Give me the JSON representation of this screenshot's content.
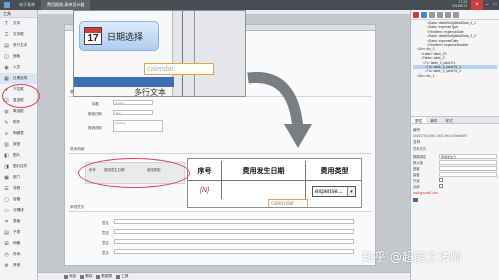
{
  "titlebar": {
    "tabs": [
      "电子表单",
      "费用报销-表单设计器"
    ],
    "clock_time": "17:23",
    "clock_date": "2018/6/13",
    "close_label": "×",
    "minimize_label": "–",
    "maximize_label": "□"
  },
  "toolbox": {
    "header": "工具",
    "items": [
      {
        "icon": "T",
        "label": "文本"
      },
      {
        "icon": "⎕",
        "label": "文本框"
      },
      {
        "icon": "▤",
        "label": "多行文本"
      },
      {
        "icon": "◫",
        "label": "面板"
      },
      {
        "icon": "◉",
        "label": "人员"
      },
      {
        "icon": "▦",
        "label": "日期选择"
      },
      {
        "icon": "▾",
        "label": "下拉框"
      },
      {
        "icon": "☑",
        "label": "复选框"
      },
      {
        "icon": "◍",
        "label": "单选框"
      },
      {
        "icon": "✎",
        "label": "附件"
      },
      {
        "icon": "≡",
        "label": "明细表"
      },
      {
        "icon": "▥",
        "label": "按钮"
      },
      {
        "icon": "◧",
        "label": "图片"
      },
      {
        "icon": "◨",
        "label": "图片控件"
      },
      {
        "icon": "▣",
        "label": "部门"
      },
      {
        "icon": "☰",
        "label": "流程"
      },
      {
        "icon": "▢",
        "label": "容器"
      },
      {
        "icon": "▭",
        "label": "分隔线"
      },
      {
        "icon": "⌗",
        "label": "表格"
      },
      {
        "icon": "▤",
        "label": "子表"
      },
      {
        "icon": "⊞",
        "label": "网格"
      },
      {
        "icon": "◷",
        "label": "时间"
      },
      {
        "icon": "⚙",
        "label": "其他"
      }
    ]
  },
  "canvas": {
    "section1_title": "基本信息",
    "section1_fields": [
      {
        "label": "标题",
        "placeholder": "textbox"
      },
      {
        "label": "报销日期",
        "placeholder": "date"
      },
      {
        "label": "报销说明",
        "placeholder": "textarea"
      }
    ],
    "section2_title": "费用明细",
    "table_headers": [
      "序号",
      "费用发生日期",
      "费用类型"
    ],
    "section3_title": "审批意见",
    "approval_rows": [
      "意见",
      "意见",
      "意见",
      "意见"
    ]
  },
  "callout_top": {
    "calendar_day": "17",
    "button_label": "日期选择",
    "field_placeholder": "calendar",
    "bottom_text": "多行文本"
  },
  "callout_bottom": {
    "headers": [
      "序号",
      "费用发生日期",
      "费用类型"
    ],
    "row_index": "{N}",
    "select_value": "expense...",
    "field_placeholder": "calendar"
  },
  "right_panel": {
    "tree": [
      "<Data> detailGrid[detailData_2_1",
      "<Data> expenseType",
      "<TextItem> expenseDate",
      "<Data> detailGrid[detailData_2_2",
      "<Data> expenseDate",
      "<TextItem> expenseNumber",
      "<Div> div_3",
      "<Label> label_19",
      "<Table> table_3",
      "<Tr> table_3_tableTr1",
      "<Td> table_3_tableTd_1",
      "<Td> table_3_tableTd_2",
      "<Div> div_1"
    ],
    "tree_selected_index": 10,
    "tabs": [
      "属性",
      "事件",
      "样式"
    ],
    "id_label": "编号",
    "id_value": "d026279d-55b1-4f00-9ec0-53ed689f",
    "name_label": "名称",
    "name_value": "表单控件",
    "props": [
      {
        "label": "数据绑定",
        "value": "费用发生日"
      },
      {
        "label": "默认值",
        "value": ""
      },
      {
        "label": "宽度",
        "value": ""
      },
      {
        "label": "高度",
        "value": ""
      },
      {
        "label": "只读",
        "value": ""
      },
      {
        "label": "必填",
        "value": ""
      }
    ],
    "red_note": "backgroundColor",
    "accent_color": "#2e6fd0"
  },
  "statusbar": {
    "items": [
      "添加",
      "删除",
      "数据源",
      "工具"
    ]
  },
  "watermark": "知乎 @超能之法师"
}
